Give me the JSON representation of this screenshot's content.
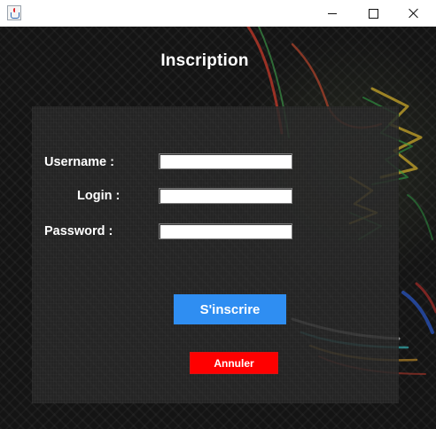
{
  "window": {
    "title": "",
    "icon": "java-cup-icon",
    "controls": {
      "minimize": "minimize-icon",
      "maximize": "maximize-icon",
      "close": "close-icon"
    }
  },
  "form": {
    "heading": "Inscription",
    "fields": {
      "username": {
        "label": "Username :",
        "value": ""
      },
      "login": {
        "label": "Login :",
        "value": ""
      },
      "password": {
        "label": "Password :",
        "value": ""
      }
    },
    "buttons": {
      "signup": "S'inscrire",
      "cancel": "Annuler"
    }
  },
  "colors": {
    "signup_button": "#2f8ef2",
    "cancel_button": "#ff0000",
    "background": "#141414"
  }
}
